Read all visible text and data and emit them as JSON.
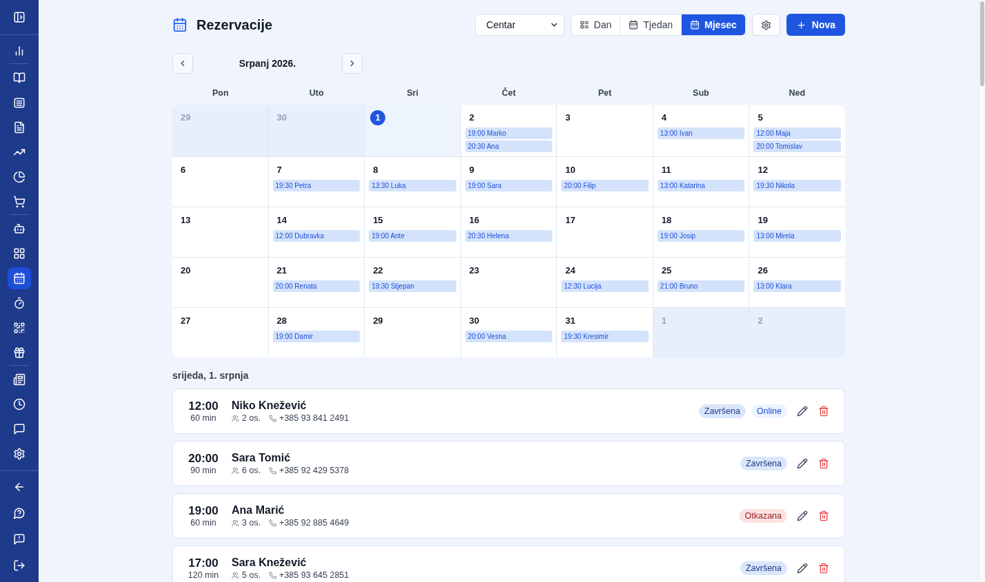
{
  "sidebar": {
    "sections": [
      {
        "items": [
          {
            "selected": false
          }
        ]
      },
      {
        "items": [
          {
            "selected": false
          },
          {
            "selected": false
          },
          {
            "selected": false
          },
          {
            "selected": false
          },
          {
            "selected": false
          },
          {
            "selected": false
          }
        ]
      },
      {
        "items": [
          {
            "selected": false
          },
          {
            "selected": false
          },
          {
            "selected": true
          },
          {
            "selected": false
          },
          {
            "selected": false
          },
          {
            "selected": false
          }
        ]
      },
      {
        "items": [
          {
            "selected": false
          },
          {
            "selected": false
          },
          {
            "selected": false
          },
          {
            "selected": false
          }
        ]
      }
    ]
  },
  "header": {
    "title": "Rezervacije",
    "location": {
      "value": "Centar"
    },
    "views": [
      {
        "label": "Dan",
        "selected": false
      },
      {
        "label": "Tjedan",
        "selected": false
      },
      {
        "label": "Mjesec",
        "selected": true
      }
    ],
    "new_button": "Nova"
  },
  "calendar": {
    "month": "Srpanj 2026.",
    "weekdays": [
      "Pon",
      "Uto",
      "Sri",
      "Čet",
      "Pet",
      "Sub",
      "Ned"
    ],
    "weeks": [
      {
        "days": [
          {
            "day": "29",
            "outside": true,
            "selected": false
          },
          {
            "day": "30",
            "outside": true,
            "selected": false
          },
          {
            "day": "1",
            "outside": false,
            "selected": true
          },
          {
            "day": "2",
            "outside": false,
            "selected": false,
            "events": [
              "19:00 Marko",
              "20:30 Ana"
            ]
          },
          {
            "day": "3",
            "outside": false,
            "selected": false
          },
          {
            "day": "4",
            "outside": false,
            "selected": false,
            "events": [
              "13:00 Ivan"
            ]
          },
          {
            "day": "5",
            "outside": false,
            "selected": false,
            "events": [
              "12:00 Maja",
              "20:00 Tomislav"
            ]
          }
        ]
      },
      {
        "days": [
          {
            "day": "6",
            "outside": false,
            "selected": false
          },
          {
            "day": "7",
            "outside": false,
            "selected": false,
            "events": [
              "19:30 Petra"
            ]
          },
          {
            "day": "8",
            "outside": false,
            "selected": false,
            "events": [
              "13:30 Luka"
            ]
          },
          {
            "day": "9",
            "outside": false,
            "selected": false,
            "events": [
              "19:00 Sara"
            ]
          },
          {
            "day": "10",
            "outside": false,
            "selected": false,
            "events": [
              "20:00 Filip"
            ]
          },
          {
            "day": "11",
            "outside": false,
            "selected": false,
            "events": [
              "13:00 Katarina"
            ]
          },
          {
            "day": "12",
            "outside": false,
            "selected": false,
            "events": [
              "19:30 Nikola"
            ]
          }
        ]
      },
      {
        "days": [
          {
            "day": "13",
            "outside": false,
            "selected": false
          },
          {
            "day": "14",
            "outside": false,
            "selected": false,
            "events": [
              "12:00 Dubravka"
            ]
          },
          {
            "day": "15",
            "outside": false,
            "selected": false,
            "events": [
              "19:00 Ante"
            ]
          },
          {
            "day": "16",
            "outside": false,
            "selected": false,
            "events": [
              "20:30 Helena"
            ]
          },
          {
            "day": "17",
            "outside": false,
            "selected": false
          },
          {
            "day": "18",
            "outside": false,
            "selected": false,
            "events": [
              "19:00 Josip"
            ]
          },
          {
            "day": "19",
            "outside": false,
            "selected": false,
            "events": [
              "13:00 Mirela"
            ]
          }
        ]
      },
      {
        "days": [
          {
            "day": "20",
            "outside": false,
            "selected": false
          },
          {
            "day": "21",
            "outside": false,
            "selected": false,
            "events": [
              "20:00 Renata"
            ]
          },
          {
            "day": "22",
            "outside": false,
            "selected": false,
            "events": [
              "19:30 Stjepan"
            ]
          },
          {
            "day": "23",
            "outside": false,
            "selected": false
          },
          {
            "day": "24",
            "outside": false,
            "selected": false,
            "events": [
              "12:30 Lucija"
            ]
          },
          {
            "day": "25",
            "outside": false,
            "selected": false,
            "events": [
              "21:00 Bruno"
            ]
          },
          {
            "day": "26",
            "outside": false,
            "selected": false,
            "events": [
              "13:00 Klara"
            ]
          }
        ]
      },
      {
        "days": [
          {
            "day": "27",
            "outside": false,
            "selected": false
          },
          {
            "day": "28",
            "outside": false,
            "selected": false,
            "events": [
              "19:00 Damir"
            ]
          },
          {
            "day": "29",
            "outside": false,
            "selected": false
          },
          {
            "day": "30",
            "outside": false,
            "selected": false,
            "events": [
              "20:00 Vesna"
            ]
          },
          {
            "day": "31",
            "outside": false,
            "selected": false,
            "events": [
              "19:30 Kresimir"
            ]
          },
          {
            "day": "1",
            "outside": true,
            "selected": false
          },
          {
            "day": "2",
            "outside": true,
            "selected": false
          }
        ]
      }
    ]
  },
  "day_list": {
    "heading": "srijeda, 1. srpnja",
    "reservations": [
      {
        "time": "12:00",
        "duration": "60 min",
        "name": "Niko Knežević",
        "guests": "2 os.",
        "phone": "+385 93 841 2491",
        "badges": [
          {
            "text": "Završena",
            "kind": "done"
          },
          {
            "text": "Online",
            "kind": "online"
          }
        ]
      },
      {
        "time": "20:00",
        "duration": "90 min",
        "name": "Sara Tomić",
        "guests": "6 os.",
        "phone": "+385 92 429 5378",
        "badges": [
          {
            "text": "Završena",
            "kind": "done"
          }
        ]
      },
      {
        "time": "19:00",
        "duration": "60 min",
        "name": "Ana Marić",
        "guests": "3 os.",
        "phone": "+385 92 885 4649",
        "badges": [
          {
            "text": "Otkazana",
            "kind": "cancelled"
          }
        ]
      },
      {
        "time": "17:00",
        "duration": "120 min",
        "name": "Sara Knežević",
        "guests": "5 os.",
        "phone": "+385 93 645 2851",
        "badges": [
          {
            "text": "Završena",
            "kind": "done"
          }
        ]
      }
    ]
  }
}
